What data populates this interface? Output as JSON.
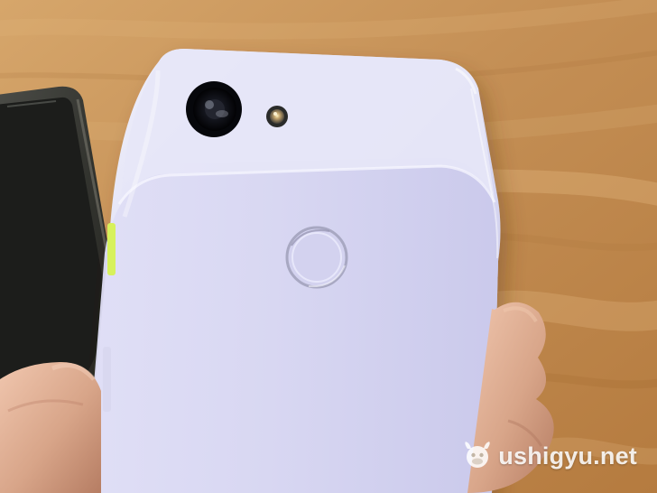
{
  "watermark": {
    "text": "ushigyu.net",
    "logo_icon": "cow-head-icon"
  },
  "colors": {
    "table": "#c48f55",
    "phone_body": "#dcdcf3",
    "phone_glass": "#d8d7f2",
    "accent_power_button": "#d7f15b",
    "watermark": "#ffffff"
  }
}
